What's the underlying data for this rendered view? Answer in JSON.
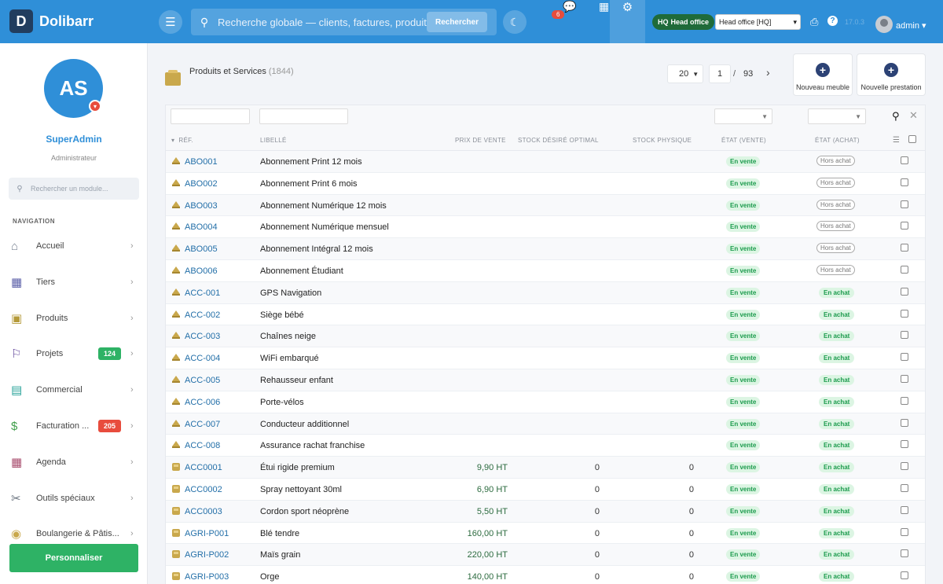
{
  "app": {
    "logo_letter": "D",
    "name": "Dolibarr"
  },
  "topbar": {
    "menu_icon": "hamburger-icon",
    "search_placeholder": "Recherche globale — clients, factures, produits...",
    "search_button": "Rechercher",
    "notif_count": "6",
    "hq_badge_code": "HQ",
    "hq_badge_label": "Head office",
    "hq_select_value": "Head office [HQ]",
    "version": "17.0.3",
    "user": "admin"
  },
  "sidebar": {
    "avatar_initials": "AS",
    "name": "SuperAdmin",
    "role": "Administrateur",
    "search_placeholder": "Rechercher un module...",
    "nav_title": "NAVIGATION",
    "items": [
      {
        "label": "Accueil",
        "icon": "home-icon",
        "color": "#7b8594",
        "badge": ""
      },
      {
        "label": "Tiers",
        "icon": "building-icon",
        "color": "#5b5fa8",
        "badge": ""
      },
      {
        "label": "Produits",
        "icon": "box-icon",
        "color": "#b59a3a",
        "badge": ""
      },
      {
        "label": "Projets",
        "icon": "project-icon",
        "color": "#6a4fa0",
        "badge": "124",
        "badge_color": "#2eb265"
      },
      {
        "label": "Commercial",
        "icon": "briefcase-icon",
        "color": "#2aa39a",
        "badge": ""
      },
      {
        "label": "Facturation ...",
        "icon": "invoice-icon",
        "color": "#3f9e4a",
        "badge": "205",
        "badge_color": "#e84c3d"
      },
      {
        "label": "Agenda",
        "icon": "calendar-icon",
        "color": "#a84d6e",
        "badge": ""
      },
      {
        "label": "Outils spéciaux",
        "icon": "tools-icon",
        "color": "#6a737f",
        "badge": ""
      },
      {
        "label": "Boulangerie & Pâtis...",
        "icon": "bread-icon",
        "color": "#c9a84c",
        "badge": ""
      }
    ],
    "personalize": "Personnaliser"
  },
  "main": {
    "title": "Produits et Services",
    "count": "(1844)",
    "limit": "20",
    "page": "1",
    "slash": "/",
    "total_pages": "93",
    "btn_meuble": "Nouveau meuble",
    "btn_prestation": "Nouvelle prestation"
  },
  "table": {
    "headers": {
      "ref": "RÉF.",
      "label": "LIBELLÉ",
      "price": "PRIX DE VENTE",
      "stock_opt": "STOCK DÉSIRÉ OPTIMAL",
      "stock_phys": "STOCK PHYSIQUE",
      "etat_vente": "ÉTAT (VENTE)",
      "etat_achat": "ÉTAT (ACHAT)"
    },
    "rows": [
      {
        "type": "service",
        "ref": "ABO001",
        "label": "Abonnement Print 12 mois",
        "price": "",
        "stock1": "",
        "stock2": "",
        "sell": "En vente",
        "buy": "Hors achat",
        "buy_on": false
      },
      {
        "type": "service",
        "ref": "ABO002",
        "label": "Abonnement Print 6 mois",
        "price": "",
        "stock1": "",
        "stock2": "",
        "sell": "En vente",
        "buy": "Hors achat",
        "buy_on": false
      },
      {
        "type": "service",
        "ref": "ABO003",
        "label": "Abonnement Numérique 12 mois",
        "price": "",
        "stock1": "",
        "stock2": "",
        "sell": "En vente",
        "buy": "Hors achat",
        "buy_on": false
      },
      {
        "type": "service",
        "ref": "ABO004",
        "label": "Abonnement Numérique mensuel",
        "price": "",
        "stock1": "",
        "stock2": "",
        "sell": "En vente",
        "buy": "Hors achat",
        "buy_on": false
      },
      {
        "type": "service",
        "ref": "ABO005",
        "label": "Abonnement Intégral 12 mois",
        "price": "",
        "stock1": "",
        "stock2": "",
        "sell": "En vente",
        "buy": "Hors achat",
        "buy_on": false
      },
      {
        "type": "service",
        "ref": "ABO006",
        "label": "Abonnement Étudiant",
        "price": "",
        "stock1": "",
        "stock2": "",
        "sell": "En vente",
        "buy": "Hors achat",
        "buy_on": false
      },
      {
        "type": "service",
        "ref": "ACC-001",
        "label": "GPS Navigation",
        "price": "",
        "stock1": "",
        "stock2": "",
        "sell": "En vente",
        "buy": "En achat",
        "buy_on": true
      },
      {
        "type": "service",
        "ref": "ACC-002",
        "label": "Siège bébé",
        "price": "",
        "stock1": "",
        "stock2": "",
        "sell": "En vente",
        "buy": "En achat",
        "buy_on": true
      },
      {
        "type": "service",
        "ref": "ACC-003",
        "label": "Chaînes neige",
        "price": "",
        "stock1": "",
        "stock2": "",
        "sell": "En vente",
        "buy": "En achat",
        "buy_on": true
      },
      {
        "type": "service",
        "ref": "ACC-004",
        "label": "WiFi embarqué",
        "price": "",
        "stock1": "",
        "stock2": "",
        "sell": "En vente",
        "buy": "En achat",
        "buy_on": true
      },
      {
        "type": "service",
        "ref": "ACC-005",
        "label": "Rehausseur enfant",
        "price": "",
        "stock1": "",
        "stock2": "",
        "sell": "En vente",
        "buy": "En achat",
        "buy_on": true
      },
      {
        "type": "service",
        "ref": "ACC-006",
        "label": "Porte-vélos",
        "price": "",
        "stock1": "",
        "stock2": "",
        "sell": "En vente",
        "buy": "En achat",
        "buy_on": true
      },
      {
        "type": "service",
        "ref": "ACC-007",
        "label": "Conducteur additionnel",
        "price": "",
        "stock1": "",
        "stock2": "",
        "sell": "En vente",
        "buy": "En achat",
        "buy_on": true
      },
      {
        "type": "service",
        "ref": "ACC-008",
        "label": "Assurance rachat franchise",
        "price": "",
        "stock1": "",
        "stock2": "",
        "sell": "En vente",
        "buy": "En achat",
        "buy_on": true
      },
      {
        "type": "product",
        "ref": "ACC0001",
        "label": "Étui rigide premium",
        "price": "9,90 HT",
        "stock1": "0",
        "stock2": "0",
        "sell": "En vente",
        "buy": "En achat",
        "buy_on": true
      },
      {
        "type": "product",
        "ref": "ACC0002",
        "label": "Spray nettoyant 30ml",
        "price": "6,90 HT",
        "stock1": "0",
        "stock2": "0",
        "sell": "En vente",
        "buy": "En achat",
        "buy_on": true
      },
      {
        "type": "product",
        "ref": "ACC0003",
        "label": "Cordon sport néoprène",
        "price": "5,50 HT",
        "stock1": "0",
        "stock2": "0",
        "sell": "En vente",
        "buy": "En achat",
        "buy_on": true
      },
      {
        "type": "product",
        "ref": "AGRI-P001",
        "label": "Blé tendre",
        "price": "160,00 HT",
        "stock1": "0",
        "stock2": "0",
        "sell": "En vente",
        "buy": "En achat",
        "buy_on": true
      },
      {
        "type": "product",
        "ref": "AGRI-P002",
        "label": "Maïs grain",
        "price": "220,00 HT",
        "stock1": "0",
        "stock2": "0",
        "sell": "En vente",
        "buy": "En achat",
        "buy_on": true
      },
      {
        "type": "product",
        "ref": "AGRI-P003",
        "label": "Orge",
        "price": "140,00 HT",
        "stock1": "0",
        "stock2": "0",
        "sell": "En vente",
        "buy": "En achat",
        "buy_on": true
      }
    ]
  }
}
